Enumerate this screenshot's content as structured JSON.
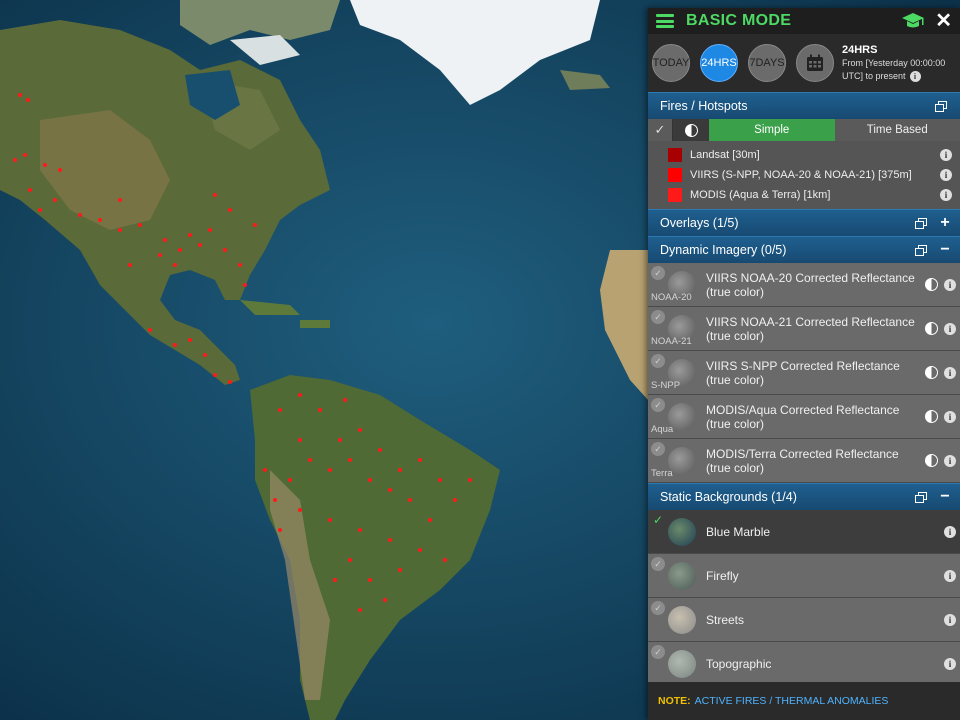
{
  "header": {
    "title": "BASIC MODE"
  },
  "time": {
    "buttons": [
      "TODAY",
      "24HRS",
      "7DAYS"
    ],
    "active": "24HRS",
    "range_title": "24HRS",
    "range_line1": "From [Yesterday 00:00:00",
    "range_line2": "UTC] to present"
  },
  "fires": {
    "title": "Fires / Hotspots",
    "tabs": [
      "Simple",
      "Time Based"
    ],
    "legend": [
      {
        "label": "Landsat [30m]",
        "color": "#a80000"
      },
      {
        "label": "VIIRS (S-NPP, NOAA-20 & NOAA-21) [375m]",
        "color": "#ff0000"
      },
      {
        "label": "MODIS (Aqua & Terra) [1km]",
        "color": "#ff1a1a"
      }
    ]
  },
  "overlays": {
    "title": "Overlays (1/5)"
  },
  "dynamic": {
    "title": "Dynamic Imagery (0/5)",
    "layers": [
      {
        "name": "VIIRS NOAA-20 Corrected Reflectance (true color)",
        "tag": "NOAA-20"
      },
      {
        "name": "VIIRS NOAA-21 Corrected Reflectance (true color)",
        "tag": "NOAA-21"
      },
      {
        "name": "VIIRS S-NPP Corrected Reflectance (true color)",
        "tag": "S-NPP"
      },
      {
        "name": "MODIS/Aqua Corrected Reflectance (true color)",
        "tag": "Aqua"
      },
      {
        "name": "MODIS/Terra Corrected Reflectance (true color)",
        "tag": "Terra"
      }
    ]
  },
  "static": {
    "title": "Static Backgrounds (1/4)",
    "layers": [
      {
        "name": "Blue Marble",
        "tag": ""
      },
      {
        "name": "Firefly",
        "tag": ""
      },
      {
        "name": "Streets",
        "tag": ""
      },
      {
        "name": "Topographic",
        "tag": ""
      }
    ]
  },
  "note": {
    "label": "NOTE:",
    "text": "ACTIVE FIRES / THERMAL ANOMALIES"
  },
  "colors": {
    "accent_green": "#4cd964",
    "active_blue": "#1e88e5",
    "fire_red": "#ff0000"
  }
}
